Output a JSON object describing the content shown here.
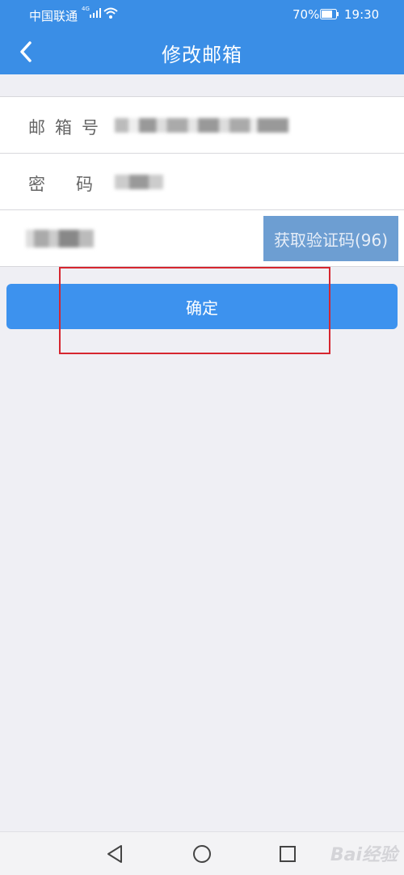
{
  "status_bar": {
    "carrier": "中国联通",
    "network": "4G",
    "battery_percent": "70%",
    "time": "19:30"
  },
  "nav": {
    "back_icon": "chevron-left-icon",
    "title": "修改邮箱"
  },
  "form": {
    "email_label": "邮箱号",
    "password_label": "密码",
    "get_code_button": "获取验证码(96)"
  },
  "confirm_button": "确定",
  "system_nav": {
    "back_icon": "triangle-back-icon",
    "home_icon": "circle-home-icon",
    "recents_icon": "square-recents-icon"
  },
  "watermark": "Bai经验",
  "colors": {
    "primary": "#3a8ee6",
    "button": "#3d92ee",
    "code_button": "#6d9ed2",
    "highlight": "#d6262f",
    "background": "#efeff4"
  }
}
